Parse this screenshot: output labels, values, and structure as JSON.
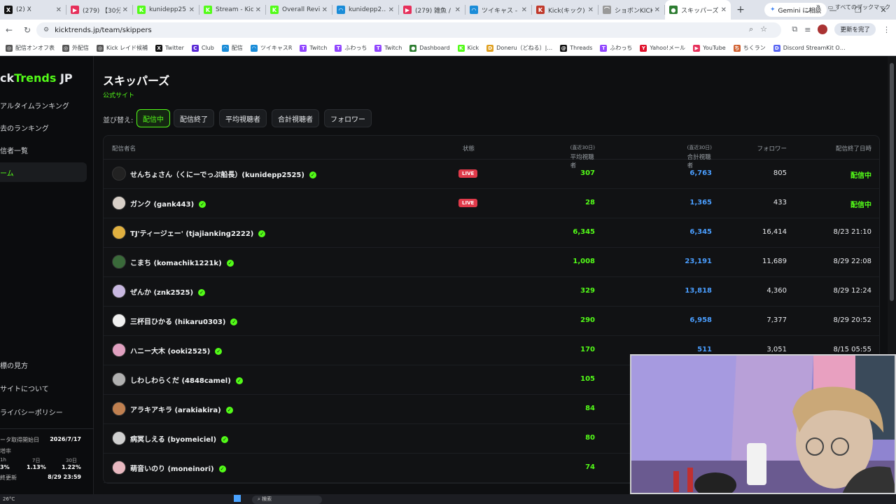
{
  "browser": {
    "tabs": [
      {
        "title": "(2) X",
        "fav_color": "#111111",
        "fav_text": "X"
      },
      {
        "title": "(279) 【30分…",
        "fav_color": "#e62f5a",
        "fav_text": "▶"
      },
      {
        "title": "kunidepp25…",
        "fav_color": "#53fc18",
        "fav_text": "K"
      },
      {
        "title": "Stream - Kic…",
        "fav_color": "#53fc18",
        "fav_text": "K"
      },
      {
        "title": "Overall Revi…",
        "fav_color": "#53fc18",
        "fav_text": "K"
      },
      {
        "title": "kunidepp2…",
        "fav_color": "#1a8cd8",
        "fav_text": "◠"
      },
      {
        "title": "(279) 雑魚 /",
        "fav_color": "#e62f5a",
        "fav_text": "▶"
      },
      {
        "title": "ツイキャス - ラ…",
        "fav_color": "#1a8cd8",
        "fav_text": "◠"
      },
      {
        "title": "Kick(キック) |",
        "fav_color": "#c0392b",
        "fav_text": "K"
      },
      {
        "title": "ショボンKICK…",
        "fav_color": "#999999",
        "fav_text": "⌒"
      },
      {
        "title": "スキッパーズ |",
        "fav_color": "#2e7d32",
        "fav_text": "●"
      }
    ],
    "gemini_label": "Gemini に相談",
    "url": "kicktrends.jp/team/skippers",
    "update_label": "更新を完了",
    "bookmarks": [
      {
        "label": "配信オンオフ表",
        "color": "#555555",
        "icon": "◎"
      },
      {
        "label": "外配信",
        "color": "#555555",
        "icon": "◎"
      },
      {
        "label": "Kick レイド候補",
        "color": "#555555",
        "icon": "◎"
      },
      {
        "label": "Twitter",
        "color": "#111111",
        "icon": "X"
      },
      {
        "label": "Club",
        "color": "#5b2bd6",
        "icon": "C"
      },
      {
        "label": "配信",
        "color": "#1a8cd8",
        "icon": "◠"
      },
      {
        "label": "ツイキャスR",
        "color": "#1a8cd8",
        "icon": "◠"
      },
      {
        "label": "Twitch",
        "color": "#9146ff",
        "icon": "T"
      },
      {
        "label": "ふわっち",
        "color": "#9146ff",
        "icon": "T"
      },
      {
        "label": "Twitch",
        "color": "#9146ff",
        "icon": "T"
      },
      {
        "label": "Dashboard",
        "color": "#2e7d32",
        "icon": "●"
      },
      {
        "label": "Kick",
        "color": "#53fc18",
        "icon": "K"
      },
      {
        "label": "Doneru（どねる）|…",
        "color": "#e0a020",
        "icon": "D"
      },
      {
        "label": "Threads",
        "color": "#111111",
        "icon": "@"
      },
      {
        "label": "ふわっち",
        "color": "#9146ff",
        "icon": "T"
      },
      {
        "label": "Yahoo!メール",
        "color": "#e0112b",
        "icon": "Y"
      },
      {
        "label": "YouTube",
        "color": "#e62f5a",
        "icon": "▶"
      },
      {
        "label": "ちくラン",
        "color": "#d06030",
        "icon": "ち"
      },
      {
        "label": "Discord StreamKit O…",
        "color": "#5865f2",
        "icon": "D"
      }
    ],
    "all_bookmarks": "すべてのブックマーク"
  },
  "sidebar": {
    "logo_left": "ck",
    "logo_green": "Trends",
    "logo_right": " JP",
    "items": [
      {
        "label": "アルタイムランキング"
      },
      {
        "label": "去のランキング"
      },
      {
        "label": "信者一覧"
      },
      {
        "label": "ーム"
      },
      {
        "label": "標の見方"
      },
      {
        "label": "サイトについて"
      },
      {
        "label": "ライバシーポリシー"
      }
    ],
    "stats": {
      "start_label": "ータ取得開始日",
      "start_value": "2026/7/17",
      "rate_label": "増率",
      "c1_head": "1h",
      "c2_head": "7日",
      "c3_head": "30日",
      "c1_val": "3%",
      "c2_val": "1.13%",
      "c3_val": "1.22%",
      "updated_label": "終更新",
      "updated_value": "8/29 23:59"
    }
  },
  "main": {
    "title": "スキッパーズ",
    "official": "公式サイト",
    "sort_label": "並び替え:",
    "sort_options": [
      "配信中",
      "配信終了",
      "平均視聴者",
      "合計視聴者",
      "フォロワー"
    ],
    "columns": {
      "name": "配信者名",
      "status": "状態",
      "avg": "平均視聴者",
      "avg_note": "(直近30日)",
      "total": "合計視聴者",
      "total_note": "(直近30日)",
      "followers": "フォロワー",
      "ended": "配信終了日時"
    },
    "live_badge": "LIVE",
    "rows": [
      {
        "name": "せんちょさん（くにーでっぷ船長）(kunidepp2525)",
        "live": true,
        "avg": "307",
        "total": "6,763",
        "followers": "805",
        "ended": "配信中",
        "avatar": "#222222"
      },
      {
        "name": "ガンク (gank443)",
        "live": true,
        "avg": "28",
        "total": "1,365",
        "followers": "433",
        "ended": "配信中",
        "avatar": "#d8d0c8"
      },
      {
        "name": "TJ'ティージェー' (tjajianking2222)",
        "live": false,
        "avg": "6,345",
        "total": "6,345",
        "followers": "16,414",
        "ended": "8/23 21:10",
        "avatar": "#e0b040"
      },
      {
        "name": "こまち (komachik1221k)",
        "live": false,
        "avg": "1,008",
        "total": "23,191",
        "followers": "11,689",
        "ended": "8/29 22:08",
        "avatar": "#3a6a3a"
      },
      {
        "name": "ぜんか (znk2525)",
        "live": false,
        "avg": "329",
        "total": "13,818",
        "followers": "4,360",
        "ended": "8/29 12:24",
        "avatar": "#c8b8e0"
      },
      {
        "name": "三杯目ひかる (hikaru0303)",
        "live": false,
        "avg": "290",
        "total": "6,958",
        "followers": "7,377",
        "ended": "8/29 20:52",
        "avatar": "#f0f0f0"
      },
      {
        "name": "ハニー大木 (ooki2525)",
        "live": false,
        "avg": "170",
        "total": "511",
        "followers": "3,051",
        "ended": "8/15 05:55",
        "avatar": "#e0a0c0"
      },
      {
        "name": "しわしわらくだ (4848camel)",
        "live": false,
        "avg": "105",
        "total": "",
        "followers": "",
        "ended": "",
        "avatar": "#b0b0b0"
      },
      {
        "name": "アラキアキラ (arakiakira)",
        "live": false,
        "avg": "84",
        "total": "",
        "followers": "",
        "ended": "",
        "avatar": "#c08050"
      },
      {
        "name": "病冥しえる (byomeiciel)",
        "live": false,
        "avg": "80",
        "total": "",
        "followers": "",
        "ended": "",
        "avatar": "#d0d0d0"
      },
      {
        "name": "萌音いのり (moneinori)",
        "live": false,
        "avg": "74",
        "total": "",
        "followers": "",
        "ended": "",
        "avatar": "#e8b8c0"
      }
    ]
  },
  "taskbar": {
    "weather": "26°C",
    "search": "検索"
  }
}
